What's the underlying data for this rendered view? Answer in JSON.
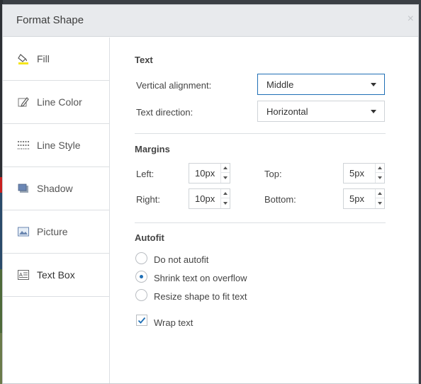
{
  "window": {
    "title": "Format Shape",
    "close_glyph": "×"
  },
  "sidebar": {
    "items": [
      {
        "label": "Fill",
        "icon": "paint-bucket-icon"
      },
      {
        "label": "Line Color",
        "icon": "pencil-icon"
      },
      {
        "label": "Line Style",
        "icon": "line-style-icon"
      },
      {
        "label": "Shadow",
        "icon": "shadow-icon"
      },
      {
        "label": "Picture",
        "icon": "picture-icon"
      },
      {
        "label": "Text Box",
        "icon": "text-box-icon",
        "active": true
      }
    ]
  },
  "text_section": {
    "title": "Text",
    "vertical_alignment": {
      "label": "Vertical alignment:",
      "value": "Middle"
    },
    "text_direction": {
      "label": "Text direction:",
      "value": "Horizontal"
    }
  },
  "margins_section": {
    "title": "Margins",
    "left": {
      "label": "Left:",
      "value": "10px"
    },
    "right": {
      "label": "Right:",
      "value": "10px"
    },
    "top": {
      "label": "Top:",
      "value": "5px"
    },
    "bottom": {
      "label": "Bottom:",
      "value": "5px"
    }
  },
  "autofit_section": {
    "title": "Autofit",
    "options": [
      {
        "label": "Do not autofit",
        "selected": false
      },
      {
        "label": "Shrink text on overflow",
        "selected": true
      },
      {
        "label": "Resize shape to fit text",
        "selected": false
      }
    ],
    "wrap_text": {
      "label": "Wrap text",
      "checked": true
    }
  },
  "colors": {
    "accent": "#1f6fb5",
    "titlebar": "#e8eaed",
    "border": "#cfd3d7"
  }
}
